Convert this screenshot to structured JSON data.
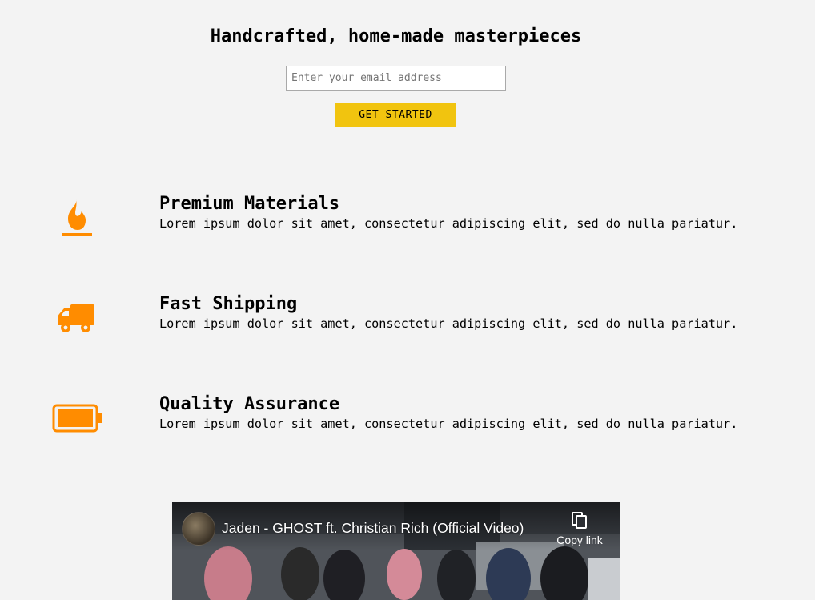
{
  "hero": {
    "title": "Handcrafted, home-made masterpieces",
    "email_placeholder": "Enter your email address",
    "cta_label": "GET STARTED"
  },
  "features": [
    {
      "icon": "fire-icon",
      "title": "Premium Materials",
      "text": "Lorem ipsum dolor sit amet, consectetur adipiscing elit, sed do nulla pariatur."
    },
    {
      "icon": "truck-icon",
      "title": "Fast Shipping",
      "text": "Lorem ipsum dolor sit amet, consectetur adipiscing elit, sed do nulla pariatur."
    },
    {
      "icon": "battery-full-icon",
      "title": "Quality Assurance",
      "text": "Lorem ipsum dolor sit amet, consectetur adipiscing elit, sed do nulla pariatur."
    }
  ],
  "video": {
    "title": "Jaden - GHOST ft. Christian Rich (Official Video)",
    "copy_link_label": "Copy link",
    "copy_icon": "copy-icon"
  },
  "colors": {
    "accent": "#f1c40f",
    "icon": "#ff8c00",
    "background": "#f3f3f3"
  }
}
